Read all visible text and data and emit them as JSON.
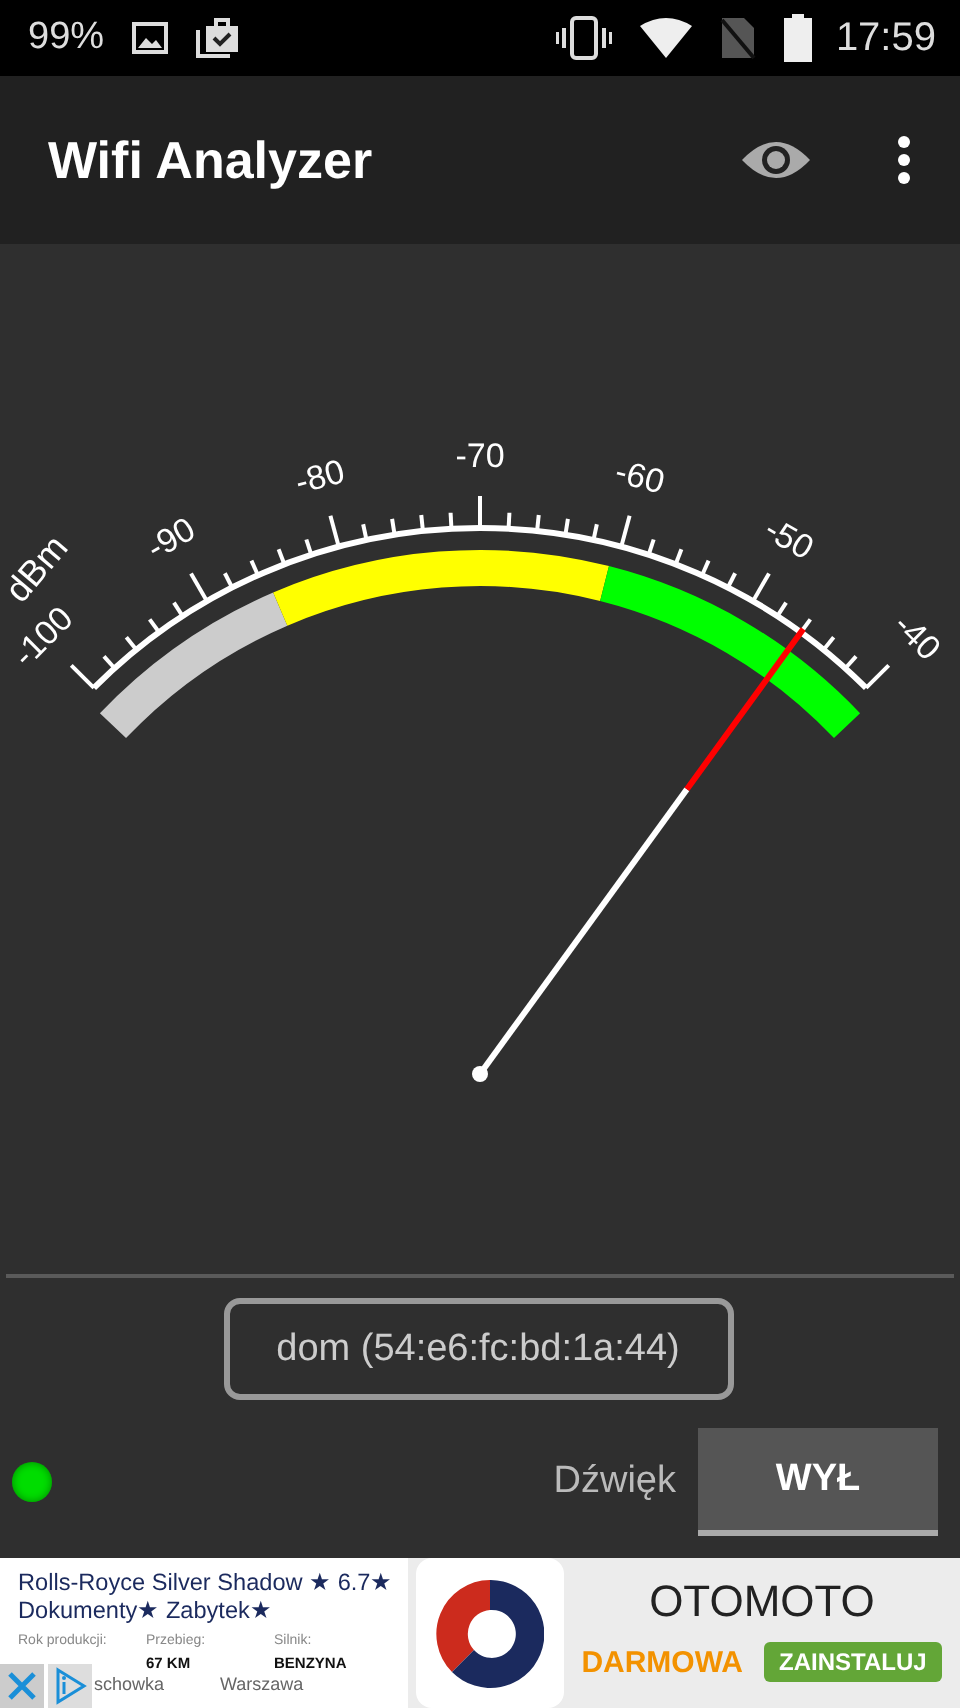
{
  "status_bar": {
    "battery_percent": "99%",
    "time": "17:59"
  },
  "app_bar": {
    "title": "Wifi Analyzer"
  },
  "meter": {
    "unit": "dBm",
    "scale_labels": [
      "-100",
      "-90",
      "-80",
      "-70",
      "-60",
      "-50",
      "-40"
    ]
  },
  "network_button": {
    "label": "dom (54:e6:fc:bd:1a:44)"
  },
  "sound": {
    "label": "Dźwięk",
    "toggle_label": "WYŁ",
    "on": false
  },
  "signal_dot": {
    "color": "#00dd00"
  },
  "ad": {
    "headline": "Rolls-Royce Silver Shadow ★ 6.7★ Dokumenty★ Zabytek★",
    "specs": [
      {
        "label": "Rok produkcji:"
      },
      {
        "label": "Przebieg:",
        "value": "67 KM"
      },
      {
        "label": "Silnik:",
        "value": "BENZYNA"
      }
    ],
    "footer": [
      "schowka",
      "Warszawa"
    ],
    "brand": "OTOMOTO",
    "price": "DARMOWA",
    "install": "ZAINSTALUJ"
  }
}
